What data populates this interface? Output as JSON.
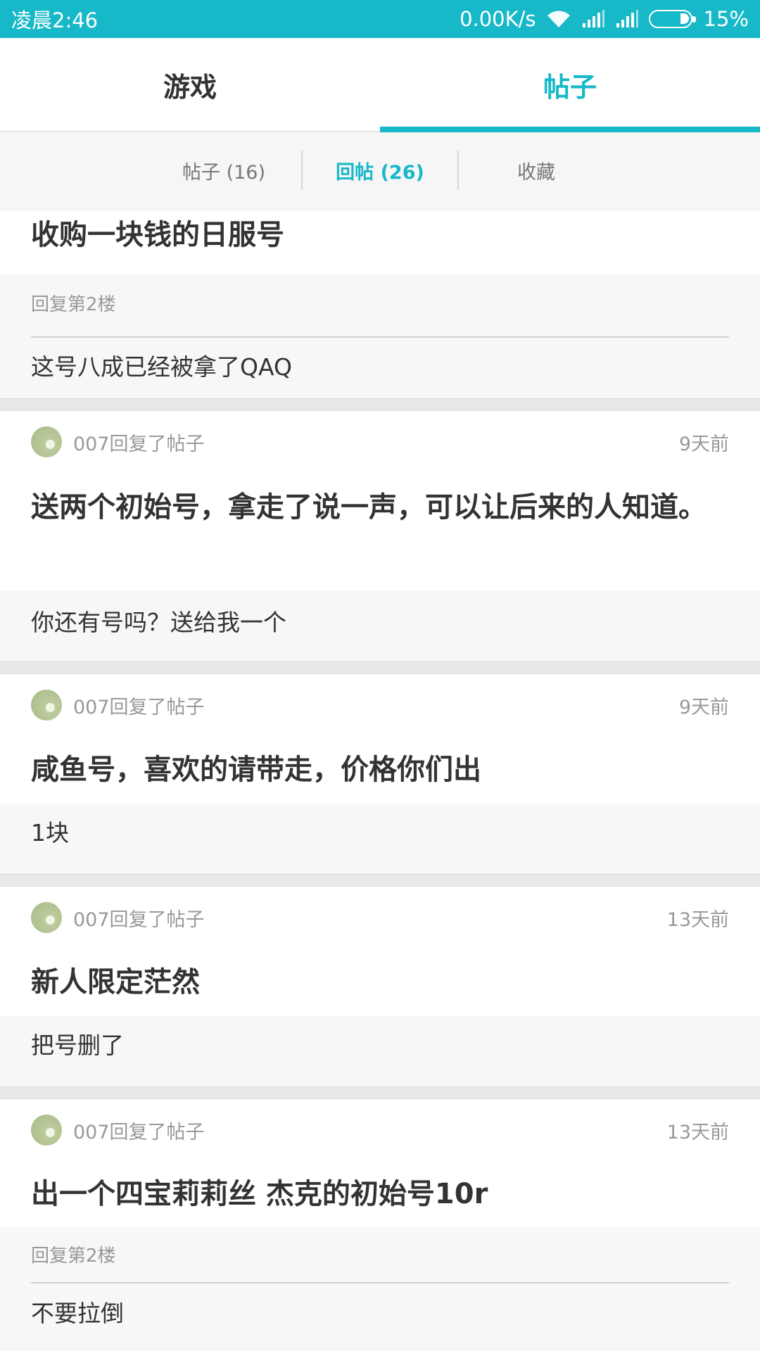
{
  "status_bar": {
    "time": "凌晨2:46",
    "net_speed": "0.00K/s",
    "battery": "15%"
  },
  "main_tabs": [
    {
      "label": "游戏"
    },
    {
      "label": "帖子"
    }
  ],
  "sub_tabs": [
    {
      "label": "帖子 (16)"
    },
    {
      "label": "回帖 (26)"
    },
    {
      "label": "收藏"
    }
  ],
  "posts": [
    {
      "title": "收购一块钱的日服号",
      "reply_floor": "回复第2楼",
      "reply": "这号八成已经被拿了QAQ"
    },
    {
      "meta": "007回复了帖子",
      "time": "9天前",
      "title": "送两个初始号，拿走了说一声，可以让后来的人知道。",
      "reply": "你还有号吗？送给我一个"
    },
    {
      "meta": "007回复了帖子",
      "time": "9天前",
      "title": "咸鱼号，喜欢的请带走，价格你们出",
      "reply": "1块"
    },
    {
      "meta": "007回复了帖子",
      "time": "13天前",
      "title": "新人限定茫然",
      "reply": "把号删了"
    },
    {
      "meta": "007回复了帖子",
      "time": "13天前",
      "title": "出一个四宝莉莉丝 杰克的初始号10r",
      "reply_floor": "回复第2楼",
      "reply": "不要拉倒"
    }
  ]
}
